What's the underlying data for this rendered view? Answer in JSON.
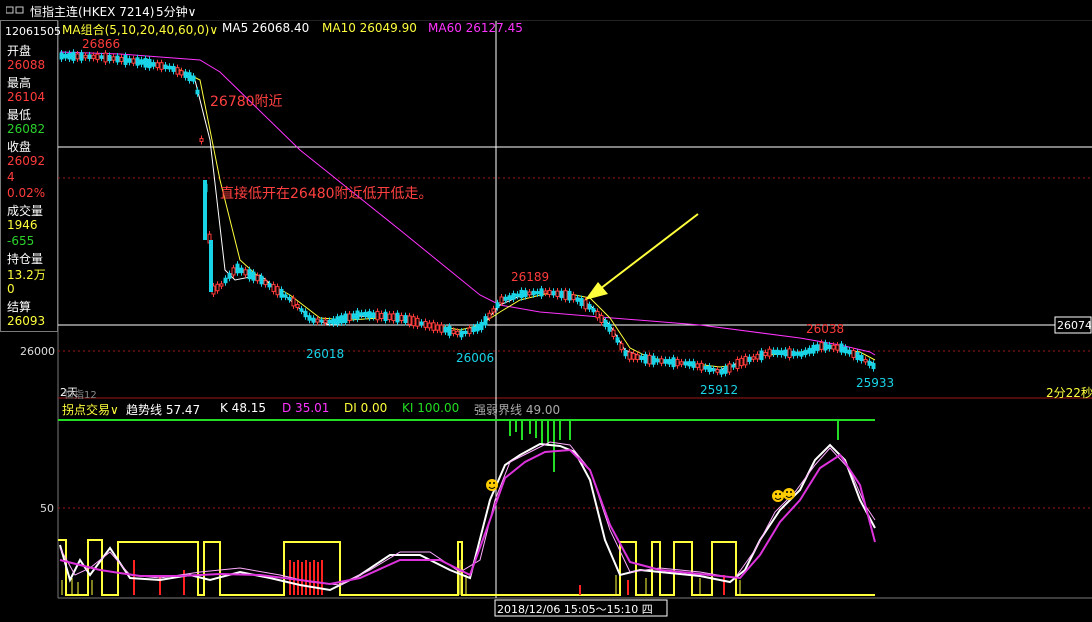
{
  "window": {
    "title": "恒指主连(HKEX 7214)",
    "period": "5分钟"
  },
  "info": {
    "time": "12061505",
    "open_label": "开盘",
    "open": "26088",
    "high_label": "最高",
    "high": "26104",
    "low_label": "最低",
    "low": "26082",
    "close_label": "收盘",
    "close": "26092",
    "change": "4",
    "change_pct": "0.02%",
    "volume_label": "成交量",
    "volume": "1946",
    "vol_change": "-655",
    "oi_label": "持仓量",
    "oi": "13.2万",
    "oi_change": "0",
    "settle_label": "结算",
    "settle": "26093"
  },
  "ma_bar": {
    "name": "MA组合(5,10,20,40,60,0)",
    "ma5": "MA5 26068.40",
    "ma10": "MA10 26049.90",
    "ma60": "MA60 26127.45",
    "colors": {
      "ma5": "#ffffff",
      "ma10": "#ffff3c",
      "ma60": "#ff33ff"
    }
  },
  "price_labels": {
    "p26866": "26866",
    "p26189": "26189",
    "p26038": "26038",
    "p26018": "26018",
    "p26006": "26006",
    "p25912": "25912",
    "p25933": "25933"
  },
  "annotations": {
    "a1": "26780附近",
    "a2": "直接低开在26480附近低开低走。"
  },
  "axis": {
    "y_main": "26000",
    "crosshair_price": "26074",
    "y_sub": "50",
    "left_small": "2天",
    "sub_name": "恒指12",
    "right_time": "2分22秒",
    "crosshair_time": "2018/12/06 15:05～15:10 四"
  },
  "sub_bar": {
    "name": "拐点交易",
    "trend": "趋势线 57.47",
    "k": "K 48.15",
    "d": "D 35.01",
    "di": "DI 0.00",
    "ki": "KI 100.00",
    "strong": "强弱界线 49.00"
  },
  "colors": {
    "up": "#ff3b3b",
    "down": "#19d3e6",
    "grid": "#a01818",
    "green": "#22dd22"
  }
}
